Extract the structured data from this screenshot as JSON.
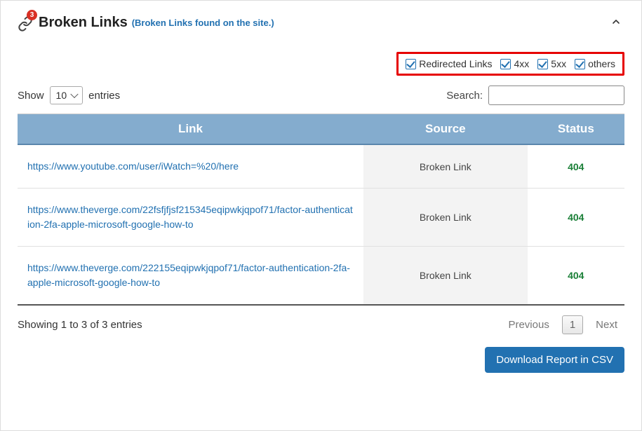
{
  "header": {
    "badge_count": "3",
    "title": "Broken Links",
    "subtitle": "(Broken Links found on the site.)"
  },
  "filters": {
    "redirected": "Redirected Links",
    "cat4xx": "4xx",
    "cat5xx": "5xx",
    "others": "others"
  },
  "length": {
    "show": "Show",
    "value": "10",
    "entries": "entries"
  },
  "search": {
    "label": "Search:",
    "value": ""
  },
  "columns": {
    "link": "Link",
    "source": "Source",
    "status": "Status"
  },
  "rows": [
    {
      "link": "https://www.youtube.com/user/iWatch=%20/here",
      "source": "Broken Link",
      "status": "404"
    },
    {
      "link": "https://www.theverge.com/22fsfjfjsf215345eqipwkjqpof71/factor-authentication-2fa-apple-microsoft-google-how-to",
      "source": "Broken Link",
      "status": "404"
    },
    {
      "link": "https://www.theverge.com/222155eqipwkjqpof71/factor-authentication-2fa-apple-microsoft-google-how-to",
      "source": "Broken Link",
      "status": "404"
    }
  ],
  "footer": {
    "info": "Showing 1 to 3 of 3 entries",
    "prev": "Previous",
    "page": "1",
    "next": "Next"
  },
  "download": {
    "label": "Download Report in CSV"
  }
}
